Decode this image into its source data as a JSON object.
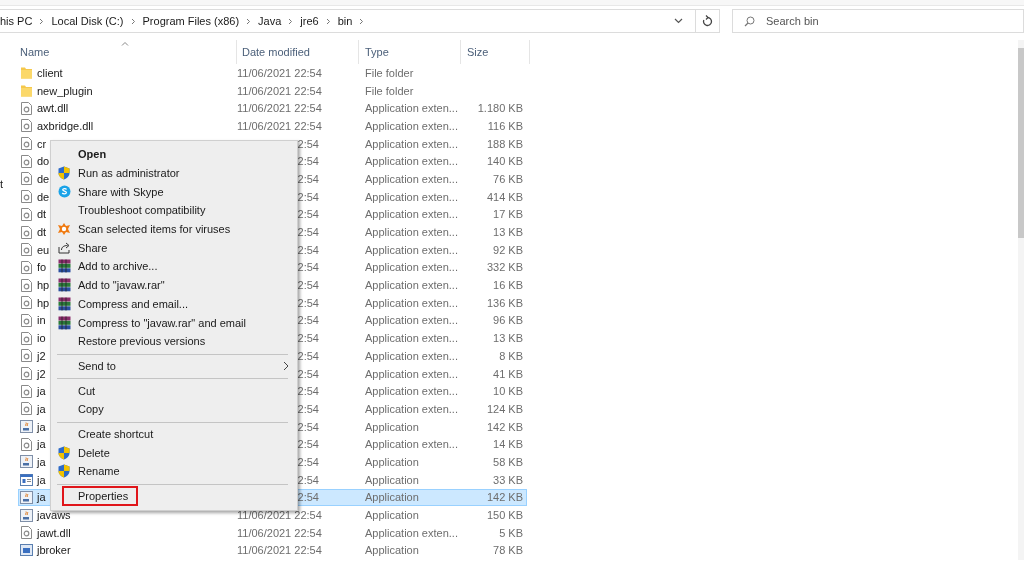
{
  "address_bar": {
    "breadcrumbs": [
      "his PC",
      "Local Disk (C:)",
      "Program Files (x86)",
      "Java",
      "jre6",
      "bin"
    ]
  },
  "search": {
    "placeholder": "Search bin"
  },
  "navigation_pane": {
    "items": [
      "t"
    ]
  },
  "columns": [
    "Name",
    "Date modified",
    "Type",
    "Size"
  ],
  "rows": [
    {
      "kind": "folder",
      "name": "client",
      "date": "11/06/2021 22:54",
      "type": "File folder",
      "size": "",
      "selected": false
    },
    {
      "kind": "folder",
      "name": "new_plugin",
      "date": "11/06/2021 22:54",
      "type": "File folder",
      "size": "",
      "selected": false
    },
    {
      "kind": "dll",
      "name": "awt.dll",
      "date": "11/06/2021 22:54",
      "type": "Application exten...",
      "size": "1.180 KB",
      "selected": false
    },
    {
      "kind": "dll",
      "name": "axbridge.dll",
      "date": "11/06/2021 22:54",
      "type": "Application exten...",
      "size": "116 KB",
      "selected": false
    },
    {
      "kind": "dll",
      "name": "cr",
      "date": "2:54",
      "type": "Application exten...",
      "size": "188 KB",
      "selected": false
    },
    {
      "kind": "dll",
      "name": "do",
      "date": "2:54",
      "type": "Application exten...",
      "size": "140 KB",
      "selected": false
    },
    {
      "kind": "dll",
      "name": "de",
      "date": "2:54",
      "type": "Application exten...",
      "size": "76 KB",
      "selected": false
    },
    {
      "kind": "dll",
      "name": "de",
      "date": "2:54",
      "type": "Application exten...",
      "size": "414 KB",
      "selected": false
    },
    {
      "kind": "dll",
      "name": "dt",
      "date": "2:54",
      "type": "Application exten...",
      "size": "17 KB",
      "selected": false
    },
    {
      "kind": "dll",
      "name": "dt",
      "date": "2:54",
      "type": "Application exten...",
      "size": "13 KB",
      "selected": false
    },
    {
      "kind": "dll",
      "name": "eu",
      "date": "2:54",
      "type": "Application exten...",
      "size": "92 KB",
      "selected": false
    },
    {
      "kind": "dll",
      "name": "fo",
      "date": "2:54",
      "type": "Application exten...",
      "size": "332 KB",
      "selected": false
    },
    {
      "kind": "dll",
      "name": "hp",
      "date": "2:54",
      "type": "Application exten...",
      "size": "16 KB",
      "selected": false
    },
    {
      "kind": "dll",
      "name": "hp",
      "date": "2:54",
      "type": "Application exten...",
      "size": "136 KB",
      "selected": false
    },
    {
      "kind": "dll",
      "name": "in",
      "date": "2:54",
      "type": "Application exten...",
      "size": "96 KB",
      "selected": false
    },
    {
      "kind": "dll",
      "name": "io",
      "date": "2:54",
      "type": "Application exten...",
      "size": "13 KB",
      "selected": false
    },
    {
      "kind": "dll",
      "name": "j2",
      "date": "2:54",
      "type": "Application exten...",
      "size": "8 KB",
      "selected": false
    },
    {
      "kind": "dll",
      "name": "j2",
      "date": "2:54",
      "type": "Application exten...",
      "size": "41 KB",
      "selected": false
    },
    {
      "kind": "dll",
      "name": "ja",
      "date": "2:54",
      "type": "Application exten...",
      "size": "10 KB",
      "selected": false
    },
    {
      "kind": "dll",
      "name": "ja",
      "date": "2:54",
      "type": "Application exten...",
      "size": "124 KB",
      "selected": false
    },
    {
      "kind": "java",
      "name": "ja",
      "date": "2:54",
      "type": "Application",
      "size": "142 KB",
      "selected": false
    },
    {
      "kind": "dll",
      "name": "ja",
      "date": "2:54",
      "type": "Application exten...",
      "size": "14 KB",
      "selected": false
    },
    {
      "kind": "java",
      "name": "ja",
      "date": "2:54",
      "type": "Application",
      "size": "58 KB",
      "selected": false
    },
    {
      "kind": "exe",
      "name": "ja",
      "date": "2:54",
      "type": "Application",
      "size": "33 KB",
      "selected": false
    },
    {
      "kind": "java",
      "name": "ja",
      "date": "2:54",
      "type": "Application",
      "size": "142 KB",
      "selected": true
    },
    {
      "kind": "java",
      "name": "javaws",
      "date": "11/06/2021 22:54",
      "type": "Application",
      "size": "150 KB",
      "selected": false
    },
    {
      "kind": "dll",
      "name": "jawt.dll",
      "date": "11/06/2021 22:54",
      "type": "Application exten...",
      "size": "5 KB",
      "selected": false
    },
    {
      "kind": "broker",
      "name": "jbroker",
      "date": "11/06/2021 22:54",
      "type": "Application",
      "size": "78 KB",
      "selected": false
    }
  ],
  "context_menu": [
    {
      "kind": "plain",
      "label": "Open",
      "bold": true,
      "submenu": false,
      "outlined": false
    },
    {
      "kind": "shield",
      "label": "Run as administrator",
      "bold": false,
      "submenu": false,
      "outlined": false
    },
    {
      "kind": "skype",
      "label": "Share with Skype",
      "bold": false,
      "submenu": false,
      "outlined": false
    },
    {
      "kind": "plain",
      "label": "Troubleshoot compatibility",
      "bold": false,
      "submenu": false,
      "outlined": false
    },
    {
      "kind": "antivirus",
      "label": "Scan selected items for viruses",
      "bold": false,
      "submenu": false,
      "outlined": false
    },
    {
      "kind": "share",
      "label": "Share",
      "bold": false,
      "submenu": false,
      "outlined": false
    },
    {
      "kind": "archiver",
      "label": "Add to archive...",
      "bold": false,
      "submenu": false,
      "outlined": false
    },
    {
      "kind": "archiver",
      "label": "Add to \"javaw.rar\"",
      "bold": false,
      "submenu": false,
      "outlined": false
    },
    {
      "kind": "archiver",
      "label": "Compress and email...",
      "bold": false,
      "submenu": false,
      "outlined": false
    },
    {
      "kind": "archiver",
      "label": "Compress to \"javaw.rar\" and email",
      "bold": false,
      "submenu": false,
      "outlined": false
    },
    {
      "kind": "plain",
      "label": "Restore previous versions",
      "bold": false,
      "submenu": false,
      "outlined": false
    },
    {
      "kind": "separator"
    },
    {
      "kind": "plain",
      "label": "Send to",
      "bold": false,
      "submenu": true,
      "outlined": false
    },
    {
      "kind": "separator"
    },
    {
      "kind": "plain",
      "label": "Cut",
      "bold": false,
      "submenu": false,
      "outlined": false
    },
    {
      "kind": "plain",
      "label": "Copy",
      "bold": false,
      "submenu": false,
      "outlined": false
    },
    {
      "kind": "separator"
    },
    {
      "kind": "plain",
      "label": "Create shortcut",
      "bold": false,
      "submenu": false,
      "outlined": false
    },
    {
      "kind": "shield",
      "label": "Delete",
      "bold": false,
      "submenu": false,
      "outlined": false
    },
    {
      "kind": "shield",
      "label": "Rename",
      "bold": false,
      "submenu": false,
      "outlined": false
    },
    {
      "kind": "separator"
    },
    {
      "kind": "plain",
      "label": "Properties",
      "bold": false,
      "submenu": false,
      "outlined": true
    }
  ]
}
